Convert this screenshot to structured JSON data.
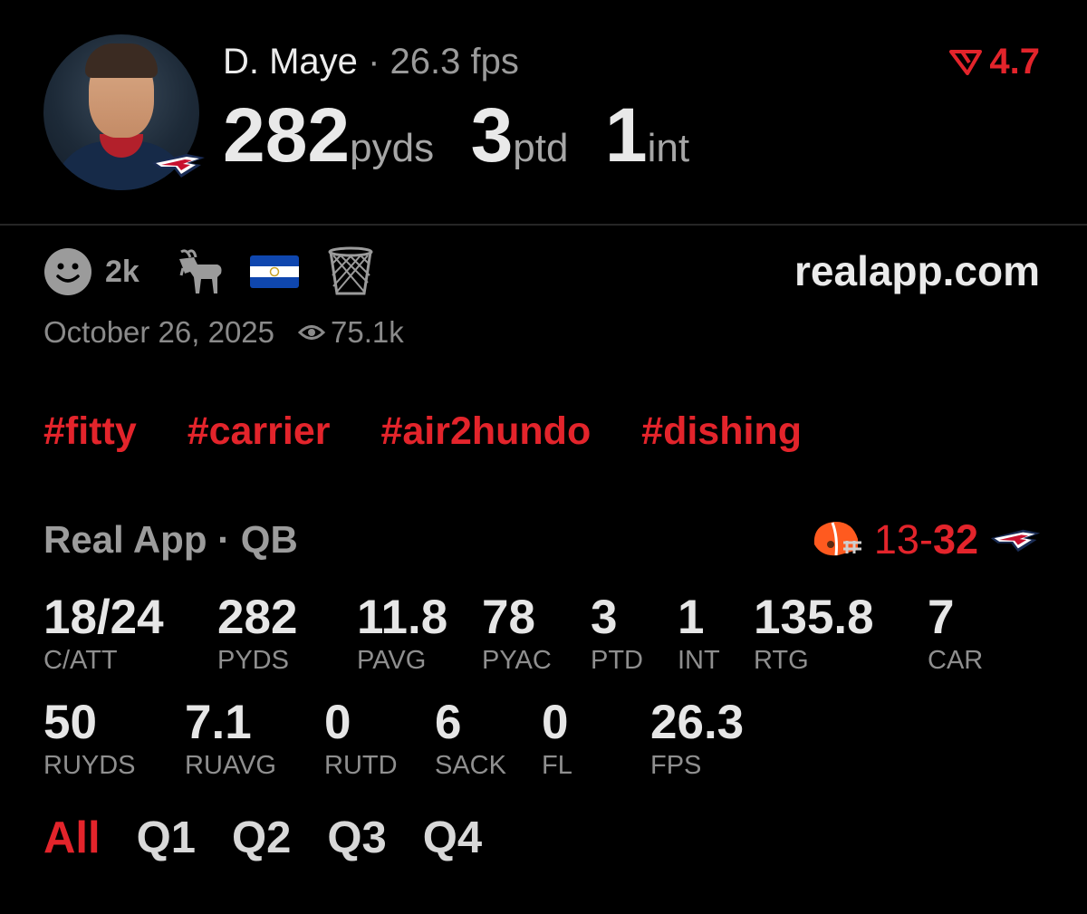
{
  "player": {
    "name": "D. Maye",
    "separator": "·",
    "fps_text": "26.3 fps",
    "passing_yards": "282",
    "passing_yards_unit": "pyds",
    "passing_tds": "3",
    "passing_tds_unit": "ptd",
    "interceptions": "1",
    "interceptions_unit": "int",
    "rating": "4.7"
  },
  "reactions": {
    "smiley_count": "2k",
    "icons": [
      "smiley-icon",
      "goat-icon",
      "el-salvador-flag-icon",
      "basketball-hoop-icon"
    ]
  },
  "site": "realapp.com",
  "meta": {
    "date": "October 26, 2025",
    "views": "75.1k"
  },
  "tags": [
    "#fitty",
    "#carrier",
    "#air2hundo",
    "#dishing"
  ],
  "source": {
    "label": "Real App · QB"
  },
  "score": {
    "away": "13",
    "dash": "-",
    "home": "32"
  },
  "stats_row1": [
    {
      "value": "18/24",
      "label": "C/ATT"
    },
    {
      "value": "282",
      "label": "PYDS"
    },
    {
      "value": "11.8",
      "label": "PAVG"
    },
    {
      "value": "78",
      "label": "PYAC"
    },
    {
      "value": "3",
      "label": "PTD"
    },
    {
      "value": "1",
      "label": "INT"
    },
    {
      "value": "135.8",
      "label": "RTG"
    },
    {
      "value": "7",
      "label": "CAR"
    }
  ],
  "stats_row2": [
    {
      "value": "50",
      "label": "RUYDS"
    },
    {
      "value": "7.1",
      "label": "RUAVG"
    },
    {
      "value": "0",
      "label": "RUTD"
    },
    {
      "value": "6",
      "label": "SACK"
    },
    {
      "value": "0",
      "label": "FL"
    },
    {
      "value": "26.3",
      "label": "FPS"
    }
  ],
  "quarters": [
    "All",
    "Q1",
    "Q2",
    "Q3",
    "Q4"
  ],
  "colors": {
    "accent": "#e3242b",
    "background": "#000000",
    "text": "#e8e8e8",
    "muted": "#8f8f8f"
  }
}
